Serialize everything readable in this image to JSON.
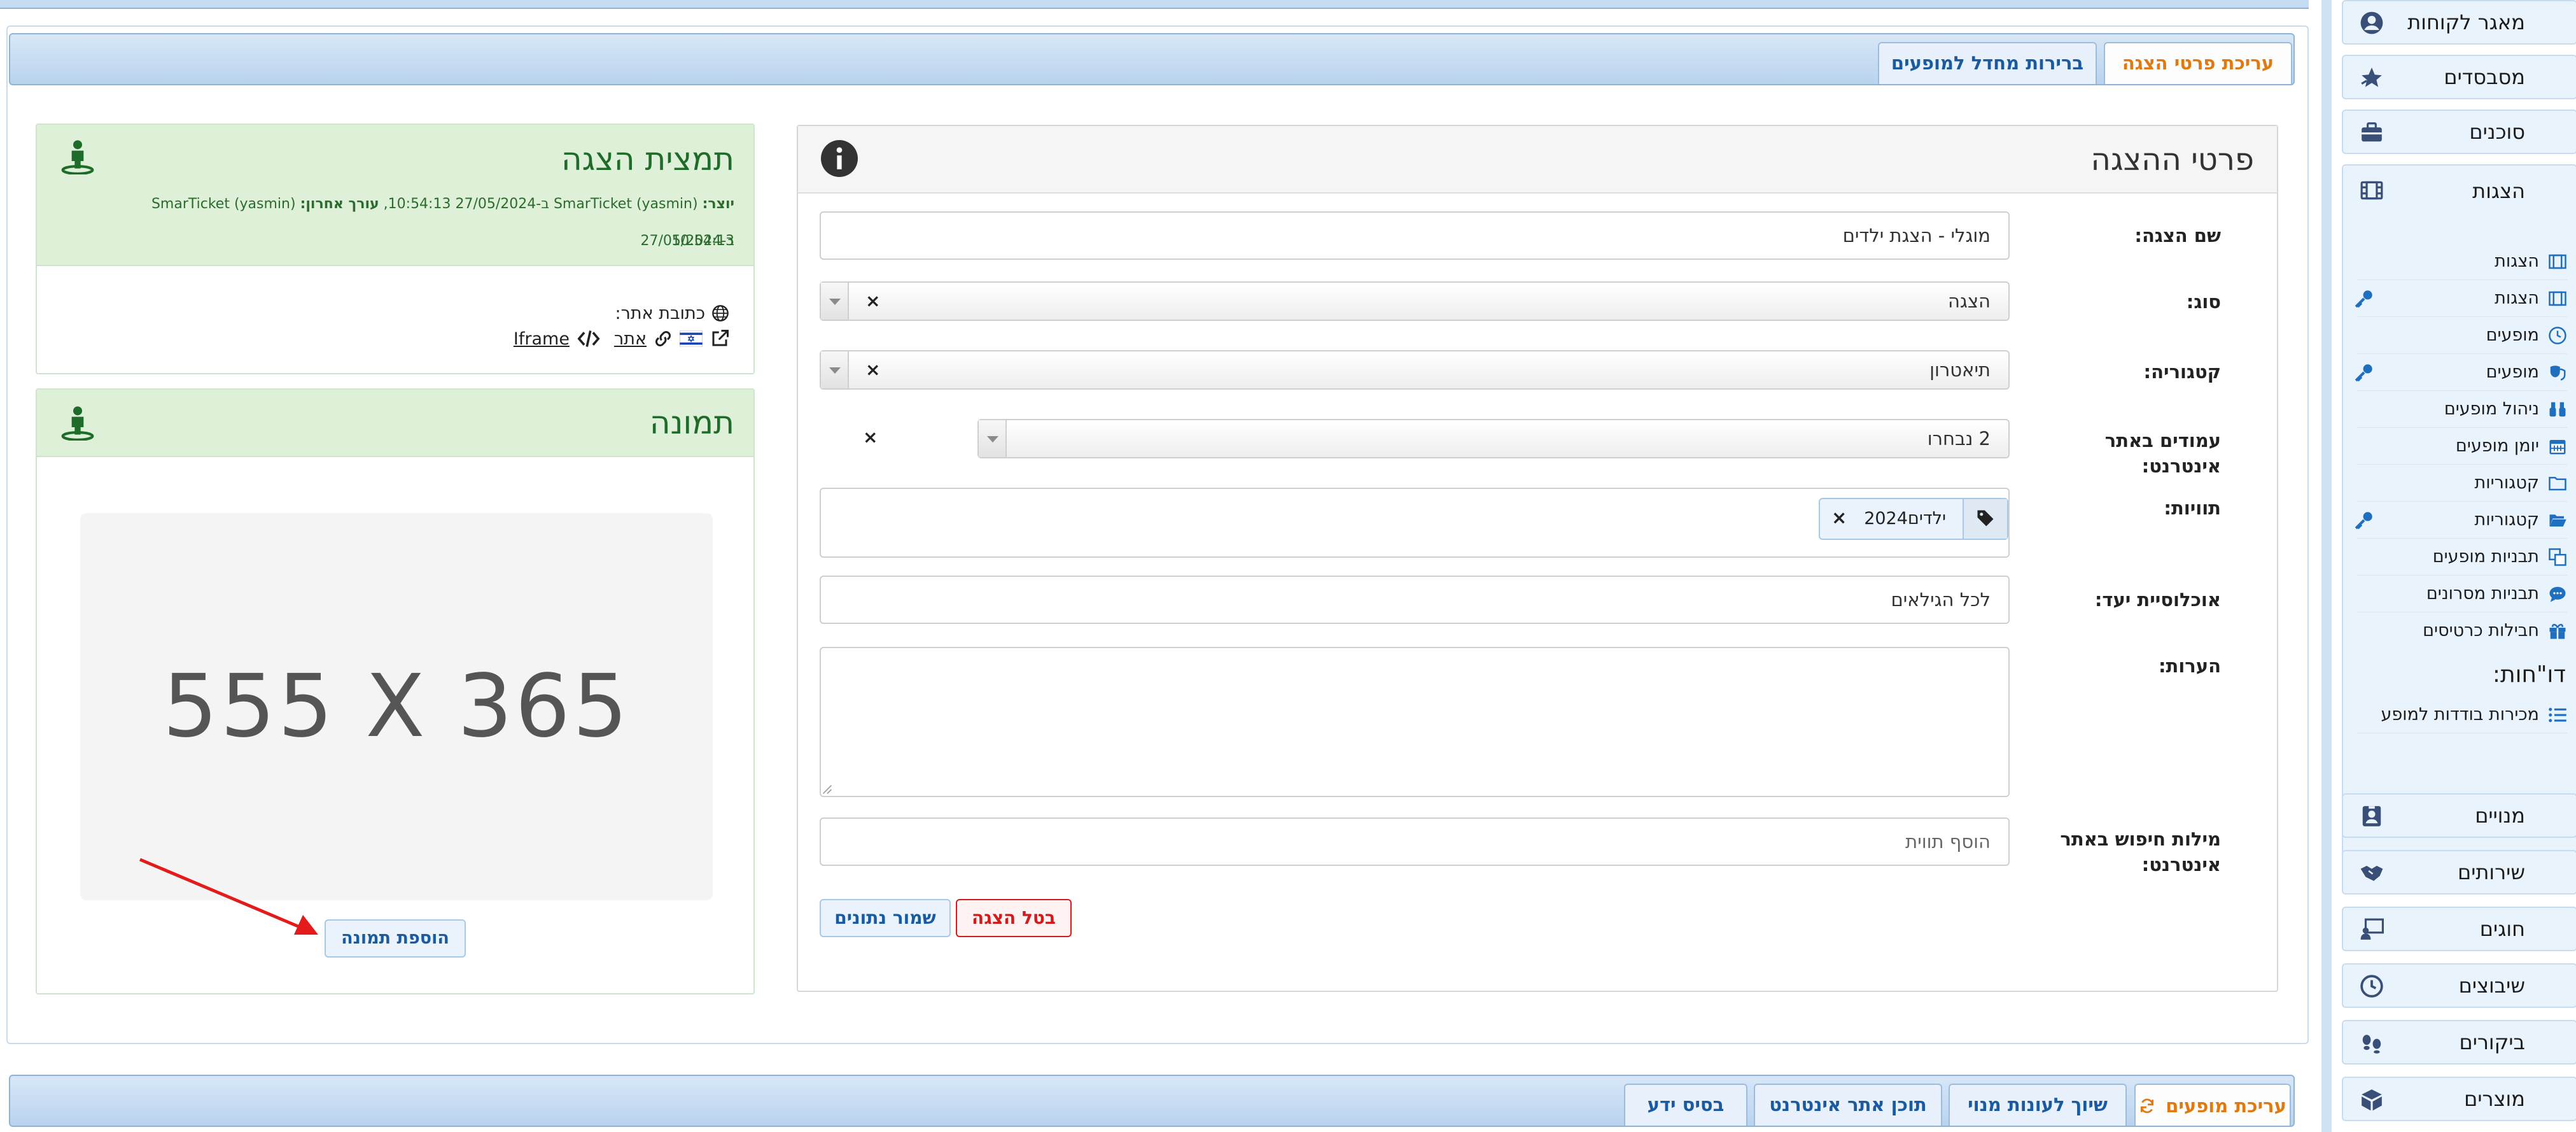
{
  "sidebar": {
    "top_items": [
      {
        "label": "מאגר לקוחות",
        "icon": "user-circle-icon"
      },
      {
        "label": "מסבסדים",
        "icon": "star-icon"
      },
      {
        "label": "סוכנים",
        "icon": "briefcase-icon"
      },
      {
        "label": "הצגות",
        "icon": "film-icon"
      }
    ],
    "sub_items": [
      {
        "label": "הצגות",
        "icon": "film-icon",
        "key": false
      },
      {
        "label": "הצגות",
        "icon": "film-icon",
        "key": true
      },
      {
        "label": "מופעים",
        "icon": "clock-icon",
        "key": false
      },
      {
        "label": "מופעים",
        "icon": "masks-icon",
        "key": true
      },
      {
        "label": "ניהול מופעים",
        "icon": "binoculars-icon",
        "key": false
      },
      {
        "label": "יומן מופעים",
        "icon": "calendar-icon",
        "key": false
      },
      {
        "label": "קטגוריות",
        "icon": "folder-icon",
        "key": false
      },
      {
        "label": "קטגוריות",
        "icon": "folder-open-icon",
        "key": true
      },
      {
        "label": "תבניות מופעים",
        "icon": "clone-icon",
        "key": false
      },
      {
        "label": "תבניות מסרונים",
        "icon": "comment-icon",
        "key": false
      },
      {
        "label": "חבילות כרטיסים",
        "icon": "gift-icon",
        "key": false
      }
    ],
    "reports_heading": "דו\"חות:",
    "report_items": [
      {
        "label": "מכירות בודדות למופע",
        "icon": "list-icon"
      }
    ],
    "bottom_items": [
      {
        "label": "מנויים",
        "icon": "id-badge-icon"
      },
      {
        "label": "שירותים",
        "icon": "handshake-icon"
      },
      {
        "label": "חוגים",
        "icon": "chalkboard-icon"
      },
      {
        "label": "שיבוצים",
        "icon": "clock-icon"
      },
      {
        "label": "ביקורים",
        "icon": "footprints-icon"
      },
      {
        "label": "מוצרים",
        "icon": "boxes-icon"
      }
    ]
  },
  "top_tabs": [
    {
      "label": "עריכת פרטי הצגה",
      "active": true
    },
    {
      "label": "ברירות מחדל למופעים",
      "active": false
    }
  ],
  "form": {
    "title": "פרטי ההצגה",
    "name_label": "שם הצגה:",
    "name_value": "מוגלי - הצגת ילדים",
    "type_label": "סוג:",
    "type_value": "הצגה",
    "category_label": "קטגוריה:",
    "category_value": "תיאטרון",
    "pages_label": "עמודים באתר אינטרנט:",
    "pages_value": "2 נבחרו",
    "tags_label": "תוויות:",
    "tag_value": "ילדים2024",
    "audience_label": "אוכלוסיית יעד:",
    "audience_value": "לכל הגילאים",
    "notes_label": "הערות:",
    "notes_value": "",
    "keywords_label": "מילות חיפוש באתר אינטרנט:",
    "keywords_placeholder": "הוסף תווית",
    "clear_symbol": "×",
    "cancel_button": "בטל הצגה",
    "save_button": "שמור נתונים"
  },
  "preview": {
    "title": "תמצית הצגה",
    "creator_label": "יוצר:",
    "creator_value": "SmarTicket (yasmin) ב-27/05/2024 10:54:13",
    "editor_label": "עורך אחרון:",
    "editor_value": "SmarTicket (yasmin) ב-27/05/2024",
    "editor_time": "10:54:13",
    "site_address_label": "כתובת אתר:",
    "link_site": "אתר",
    "link_iframe": "Iframe"
  },
  "image_panel": {
    "title": "תמונה",
    "placeholder_text": "555 X 365",
    "add_image_button": "הוספת תמונה"
  },
  "bottom_tabs": [
    {
      "label": "עריכת מופעים",
      "active": true
    },
    {
      "label": "שיוך לעונות מנוי",
      "active": false
    },
    {
      "label": "תוכן אתר אינטרנט",
      "active": false
    },
    {
      "label": "בסיס ידע",
      "active": false
    }
  ],
  "colors": {
    "accent_orange": "#e07a10",
    "link_blue": "#1a5aa0",
    "cancel_red": "#d01c1c",
    "success_green": "#1e6b2a",
    "arrow_red": "#e31b1b"
  }
}
